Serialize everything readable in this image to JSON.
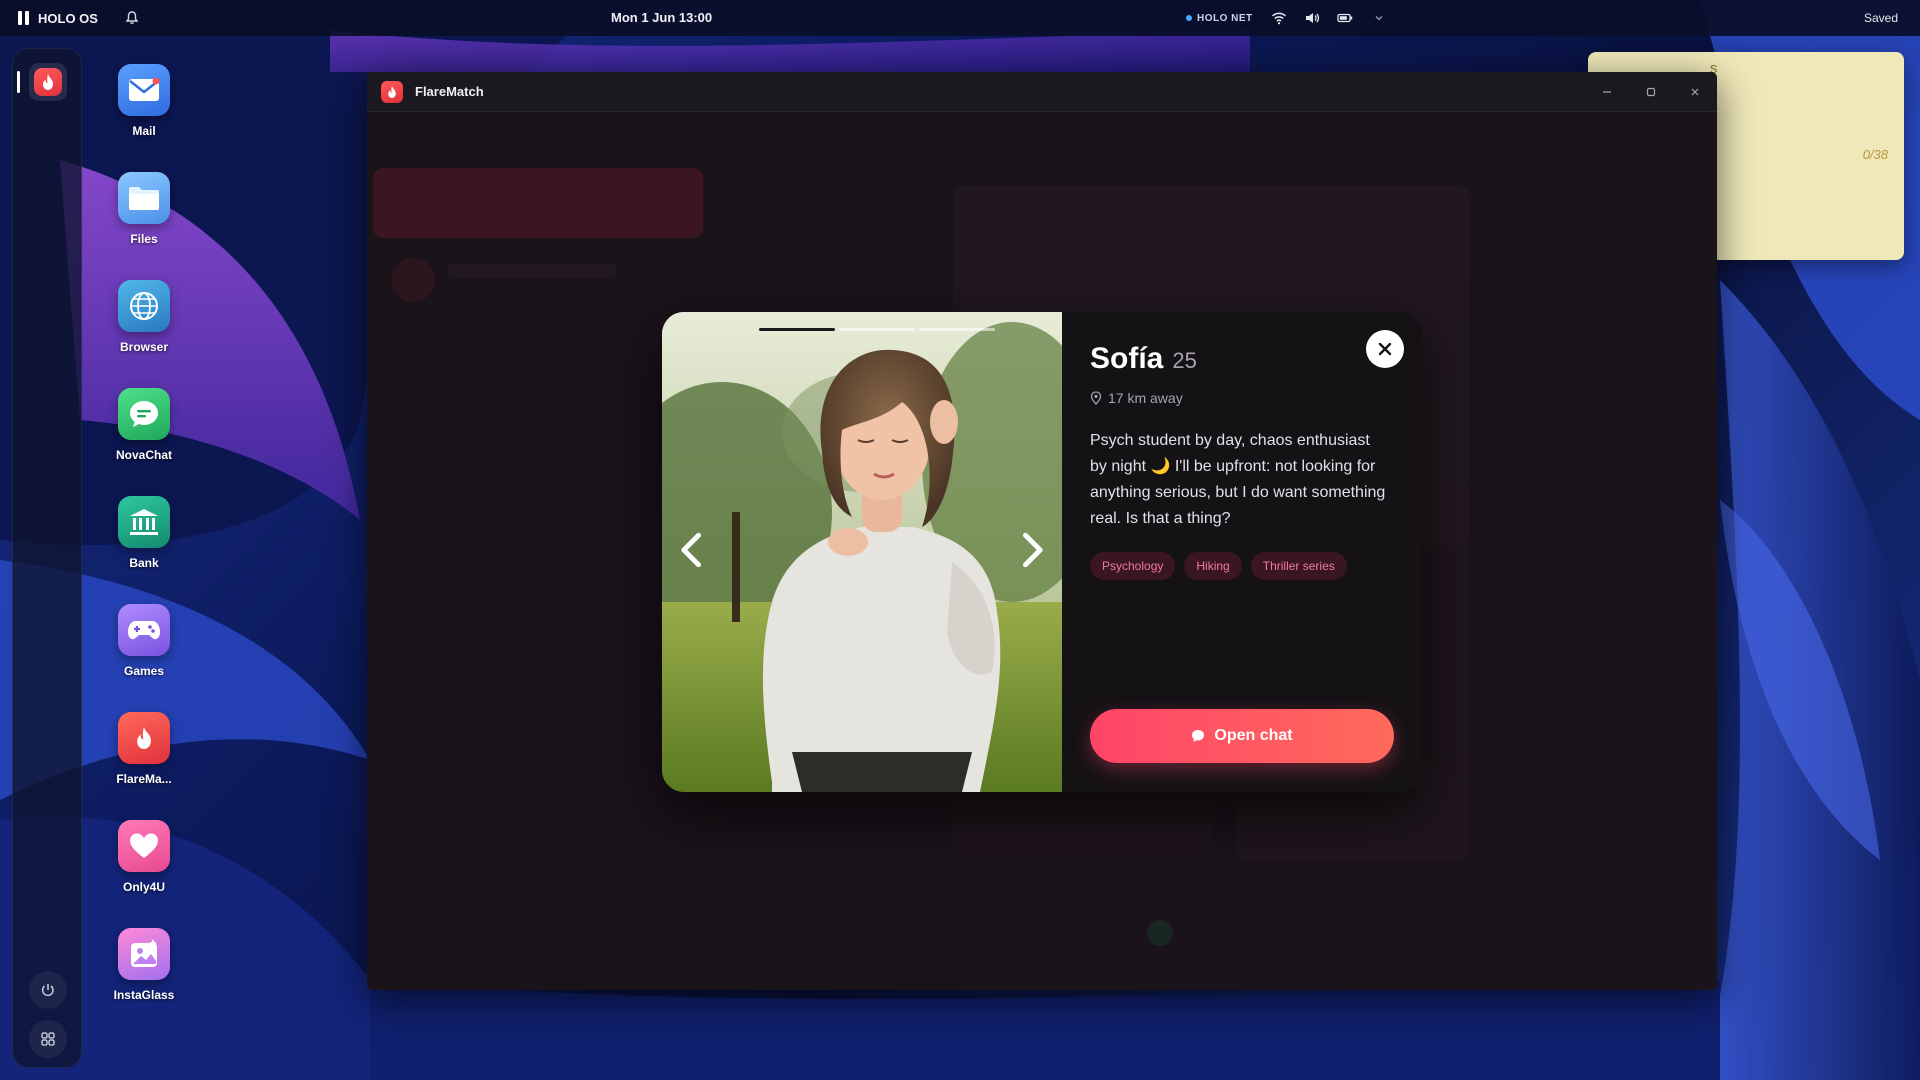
{
  "os": {
    "brand": "HOLO OS",
    "clock": "Mon 1 Jun 13:00",
    "network_label": "HOLO NET",
    "status": "Saved"
  },
  "desktop": {
    "apps": [
      {
        "label": "Mail",
        "icon": "mail-icon"
      },
      {
        "label": "Files",
        "icon": "folder-icon"
      },
      {
        "label": "Browser",
        "icon": "globe-icon"
      },
      {
        "label": "NovaChat",
        "icon": "chat-bubble-icon"
      },
      {
        "label": "Bank",
        "icon": "bank-icon"
      },
      {
        "label": "Games",
        "icon": "gamepad-icon"
      },
      {
        "label": "FlareMa...",
        "icon": "flame-icon"
      },
      {
        "label": "Only4U",
        "icon": "heart-icon"
      },
      {
        "label": "InstaGlass",
        "icon": "photo-icon"
      }
    ]
  },
  "sticky_note": {
    "fragment": "s",
    "counter": "0/38"
  },
  "window": {
    "title": "FlareMatch"
  },
  "profile": {
    "name": "Sofía",
    "age": "25",
    "distance": "17 km away",
    "bio": "Psych student by day, chaos enthusiast by night 🌙 I'll be upfront: not looking for anything serious, but I do want something real. Is that a thing?",
    "tags": [
      "Psychology",
      "Hiking",
      "Thriller series"
    ],
    "photo_count": 3,
    "photo_index": 1,
    "open_chat_label": "Open chat"
  },
  "colors": {
    "accent": "#ff4569",
    "accent_end": "#ff6a5b",
    "tag_bg": "#3a1624",
    "tag_text": "#f07a9a",
    "modal_bg": "#151216",
    "note_bg": "#efe9b9"
  }
}
